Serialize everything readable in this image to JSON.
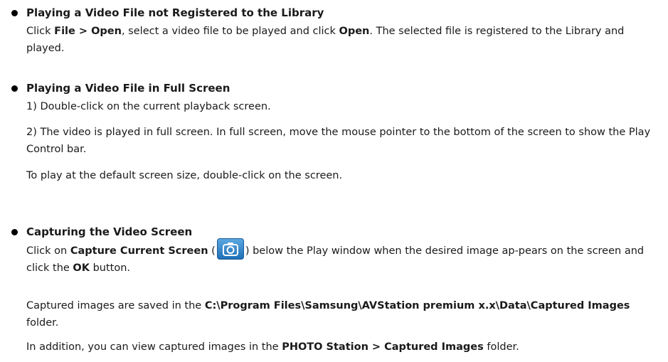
{
  "sections": [
    {
      "title": "Playing a Video File not Registered to the Library",
      "p1_a": "Click ",
      "p1_b1": "File > Open",
      "p1_c": ", select a video file to be played and click ",
      "p1_b2": "Open",
      "p1_d": ". The selected file is registered to the Library and played."
    },
    {
      "title": "Playing a Video File in Full Screen",
      "p1": "1) Double-click on the current playback screen.",
      "p2": "2) The video is played in full screen. In full screen, move the mouse pointer to the bottom of the screen to show the Play Control bar.",
      "p3": "To play at the default screen size, double-click on the screen."
    },
    {
      "title": "Capturing the Video Screen",
      "p1_a": "Click on ",
      "p1_b1": "Capture Current Screen",
      "p1_c": " (",
      "p1_d": ") below the Play window when the desired image ap-pears on the screen and click the ",
      "p1_b2": "OK",
      "p1_e": " button.",
      "p2_a": "Captured images are saved in the ",
      "p2_b": "C:\\Program Files\\Samsung\\AVStation premium x.x\\Data\\Captured Images",
      "p2_c": " folder.",
      "p3_a": "In addition, you can view captured images in the ",
      "p3_b": "PHOTO Station > Captured Images",
      "p3_c": " folder."
    }
  ],
  "icons": {
    "capture_icon": "camera-icon",
    "capture_icon_color": "#3a8fd6"
  }
}
